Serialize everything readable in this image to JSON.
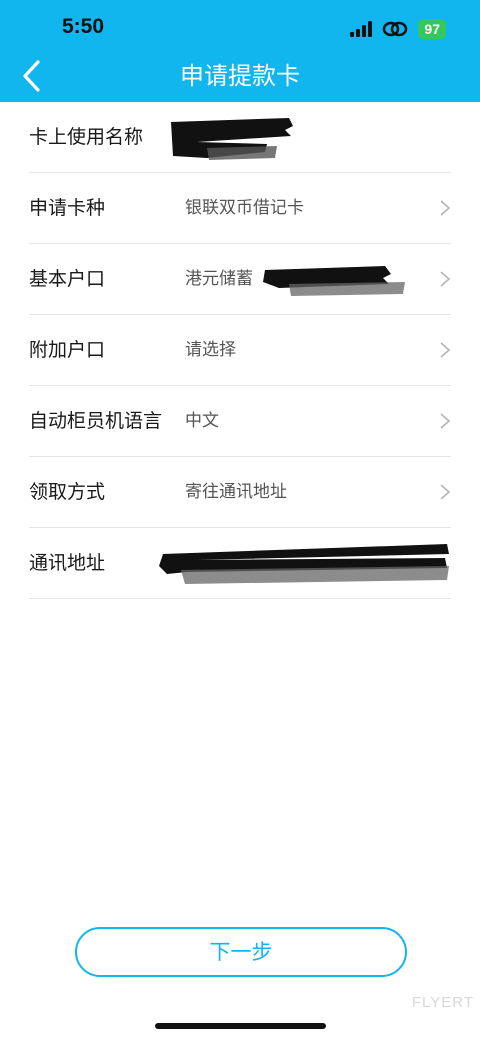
{
  "status_bar": {
    "time": "5:50",
    "battery": "97",
    "icons": [
      "signal-icon",
      "link-icon",
      "battery-icon"
    ]
  },
  "header": {
    "title": "申请提款卡",
    "back_icon": "chevron-left-icon",
    "background": "#12b6ee"
  },
  "form": {
    "rows": [
      {
        "label": "卡上使用名称",
        "value": ""
      },
      {
        "label": "申请卡种",
        "value": "银联双币借记卡"
      },
      {
        "label": "基本户口",
        "value": "港元储蓄"
      },
      {
        "label": "附加户口",
        "value": "请选择"
      },
      {
        "label": "自动柜员机语言",
        "value": "中文"
      },
      {
        "label": "领取方式",
        "value": "寄往通讯地址"
      },
      {
        "label": "通讯地址",
        "value": ""
      }
    ]
  },
  "footer": {
    "next_label": "下一步",
    "accent": "#12b6ee"
  },
  "watermark": "FLYERT"
}
